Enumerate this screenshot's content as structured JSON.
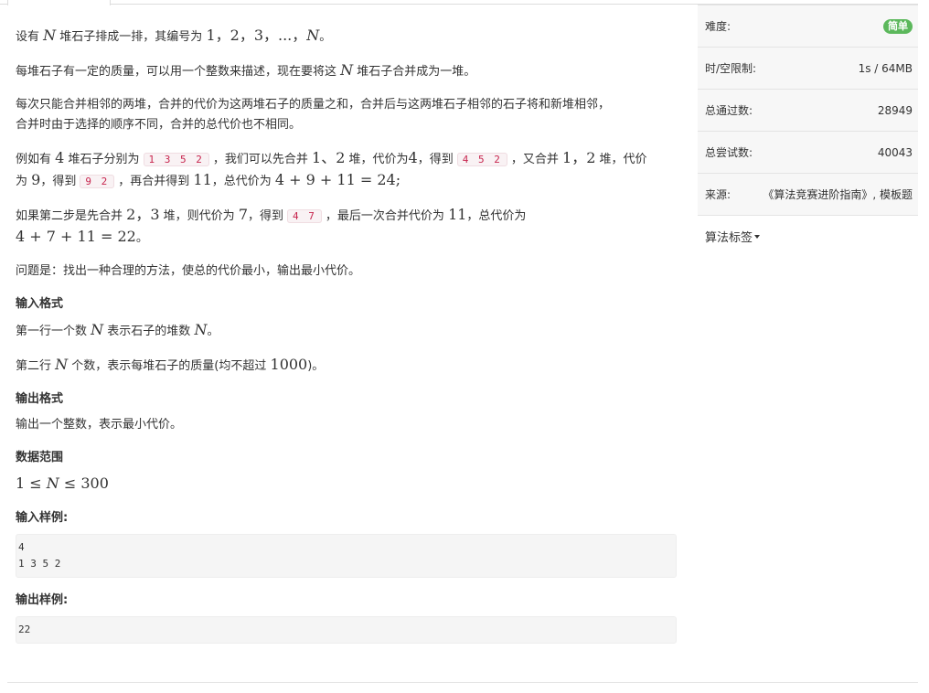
{
  "problem": {
    "p1": {
      "t1": "设有",
      "N": "N",
      "t2": "堆石子排成一排，其编号为",
      "seq": "1，2，3，...，",
      "N2": "N",
      "end": "。"
    },
    "p2": {
      "t1": "每堆石子有一定的质量，可以用一个整数来描述，现在要将这",
      "N": "N",
      "t2": "堆石子合并成为一堆。"
    },
    "p3": {
      "line1": "每次只能合并相邻的两堆，合并的代价为这两堆石子的质量之和，合并后与这两堆石子相邻的石子将和新堆相邻，",
      "line2": "合并时由于选择的顺序不同，合并的总代价也不相同。"
    },
    "p4": {
      "t1": "例如有",
      "n4": "4",
      "t2": "堆石子分别为",
      "code1": "1 3 5 2",
      "t3": "，我们可以先合并",
      "m1": "1、2",
      "t4": "堆，代价为",
      "m2": "4",
      "t5": "，得到",
      "code2": "4 5 2",
      "t6": "，又合并",
      "m3": "1，2",
      "t7": "堆，代价",
      "t8": "为",
      "m4": "9",
      "t9": "，得到",
      "code3": "9 2",
      "t10": "，再合并得到",
      "m5": "11",
      "t11": "，总代价为",
      "m6": "4 + 9 + 11 = 24;"
    },
    "p5": {
      "t1": "如果第二步是先合并",
      "m1": "2，3",
      "t2": "堆，则代价为",
      "m2": "7",
      "t3": "，得到",
      "code1": "4 7",
      "t4": "，最后一次合并代价为",
      "m3": "11",
      "t5": "，总代价为",
      "m4": "4 + 7 + 11 = 22",
      "end": "。"
    },
    "p6": "问题是：找出一种合理的方法，使总的代价最小，输出最小代价。",
    "input_heading": "输入格式",
    "in1": {
      "t1": "第一行一个数",
      "N": "N",
      "t2": "表示石子的堆数",
      "N2": "N",
      "end": "。"
    },
    "in2": {
      "t1": "第二行",
      "N": "N",
      "t2": "个数，表示每堆石子的质量(均不超过",
      "m": "1000",
      "end": ")。"
    },
    "output_heading": "输出格式",
    "out1": "输出一个整数，表示最小代价。",
    "range_heading": "数据范围",
    "range": {
      "a": "1 ≤ ",
      "N": "N",
      "b": " ≤ 300"
    },
    "sample_in_heading": "输入样例:",
    "sample_in": "4\n1 3 5 2",
    "sample_out_heading": "输出样例:",
    "sample_out": "22"
  },
  "sidebar": {
    "difficulty_label": "难度:",
    "difficulty_value": "简单",
    "difficulty_color": "#5cb85c",
    "limit_label": "时/空限制:",
    "limit_value": "1s / 64MB",
    "passed_label": "总通过数:",
    "passed_value": "28949",
    "tried_label": "总尝试数:",
    "tried_value": "40043",
    "source_label": "来源:",
    "source_value": "《算法竞赛进阶指南》, 模板题",
    "tags_label": "算法标签"
  }
}
